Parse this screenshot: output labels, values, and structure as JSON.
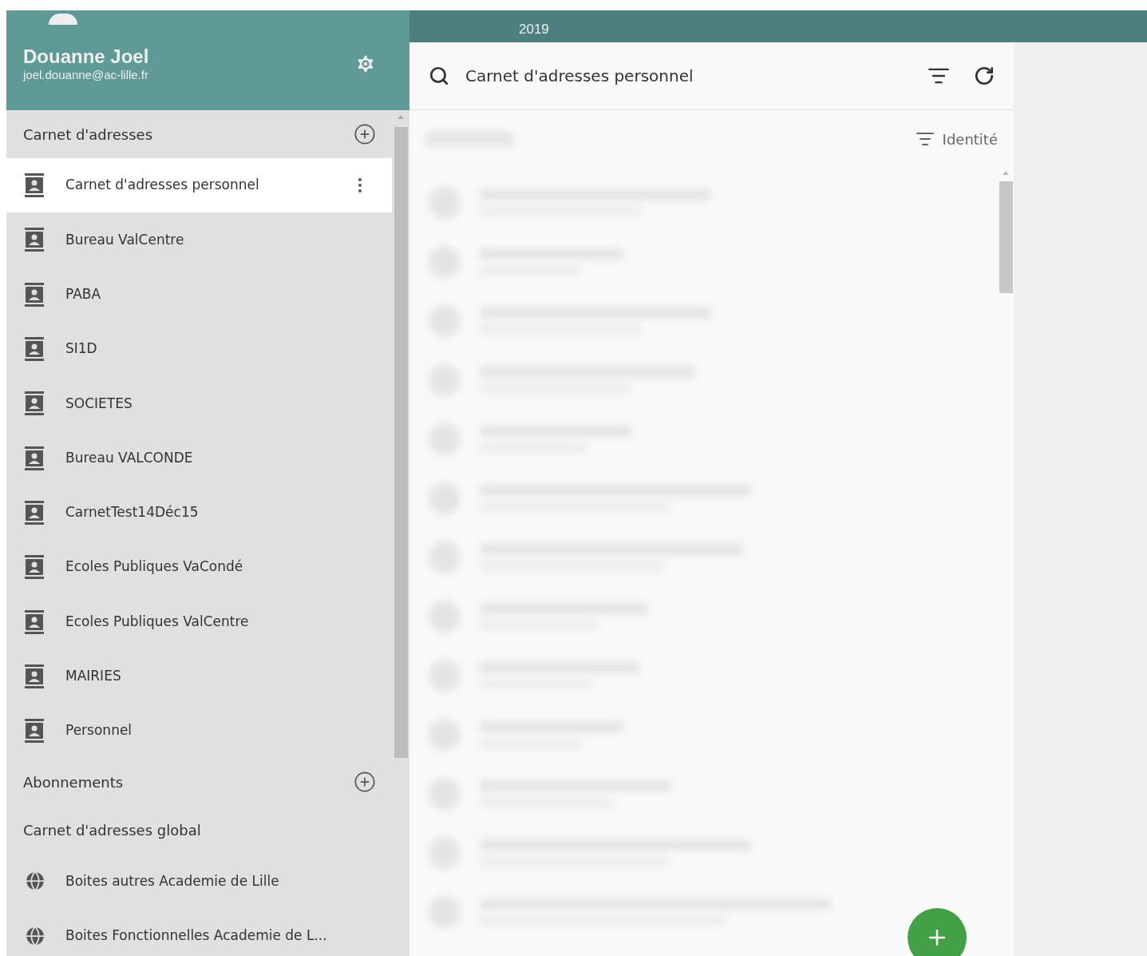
{
  "user": {
    "name": "Douanne Joel",
    "email": "joel.douanne@ac-lille.fr"
  },
  "date": {
    "year": "2019"
  },
  "sections": [
    {
      "title": "Carnet d'adresses",
      "add_button": true,
      "items": [
        {
          "label": "Carnet d'adresses personnel",
          "kind": "book",
          "selected": true
        },
        {
          "label": "Bureau ValCentre",
          "kind": "book",
          "selected": false
        },
        {
          "label": "PABA",
          "kind": "book",
          "selected": false
        },
        {
          "label": "SI1D",
          "kind": "book",
          "selected": false
        },
        {
          "label": "SOCIETES",
          "kind": "book",
          "selected": false
        },
        {
          "label": "Bureau VALCONDE",
          "kind": "book",
          "selected": false
        },
        {
          "label": "CarnetTest14Déc15",
          "kind": "book",
          "selected": false
        },
        {
          "label": "Ecoles Publiques VaCondé",
          "kind": "book",
          "selected": false
        },
        {
          "label": "Ecoles Publiques ValCentre",
          "kind": "book",
          "selected": false
        },
        {
          "label": "MAIRIES",
          "kind": "book",
          "selected": false
        },
        {
          "label": "Personnel",
          "kind": "book",
          "selected": false
        }
      ]
    },
    {
      "title": "Abonnements",
      "add_button": true
    },
    {
      "title": "Carnet d'adresses global",
      "add_button": false,
      "items": [
        {
          "label": "Boites autres Academie de Lille",
          "kind": "globe",
          "selected": false
        },
        {
          "label": "Boites Fonctionnelles Academie de L...",
          "kind": "globe",
          "selected": false
        }
      ]
    }
  ],
  "search": {
    "value": "Carnet d'adresses personnel"
  },
  "sort": {
    "label": "Identité"
  }
}
